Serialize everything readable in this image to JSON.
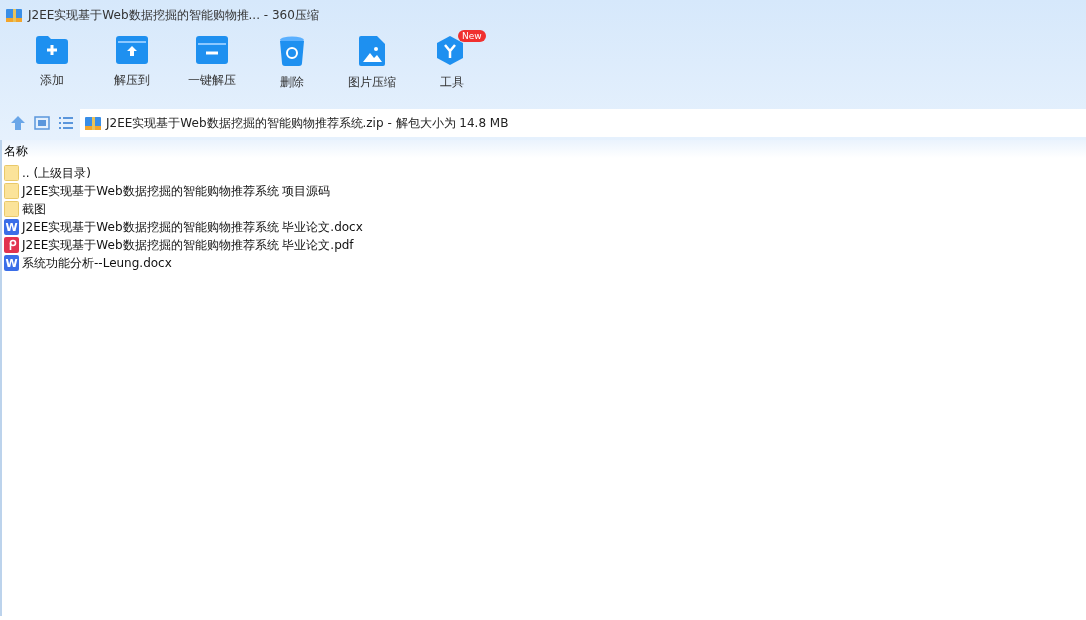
{
  "window": {
    "title": "J2EE实现基于Web数据挖掘的智能购物推... - 360压缩"
  },
  "toolbar": [
    {
      "kind": "add",
      "label": "添加"
    },
    {
      "kind": "extract",
      "label": "解压到"
    },
    {
      "kind": "oneclick",
      "label": "一键解压"
    },
    {
      "kind": "delete",
      "label": "删除"
    },
    {
      "kind": "image",
      "label": "图片压缩"
    },
    {
      "kind": "tools",
      "label": "工具",
      "badge": "New"
    }
  ],
  "address": {
    "text": "J2EE实现基于Web数据挖掘的智能购物推荐系统.zip - 解包大小为 14.8 MB"
  },
  "table": {
    "columns": [
      "名称"
    ],
    "rows": [
      {
        "kind": "folder",
        "name": ".. (上级目录)"
      },
      {
        "kind": "folder",
        "name": "J2EE实现基于Web数据挖掘的智能购物推荐系统 项目源码"
      },
      {
        "kind": "folder",
        "name": "截图"
      },
      {
        "kind": "word",
        "badge": "W",
        "name": "J2EE实现基于Web数据挖掘的智能购物推荐系统 毕业论文.docx"
      },
      {
        "kind": "pdf",
        "name": "J2EE实现基于Web数据挖掘的智能购物推荐系统 毕业论文.pdf"
      },
      {
        "kind": "word",
        "badge": "W",
        "name": "系统功能分析--Leung.docx"
      }
    ]
  }
}
